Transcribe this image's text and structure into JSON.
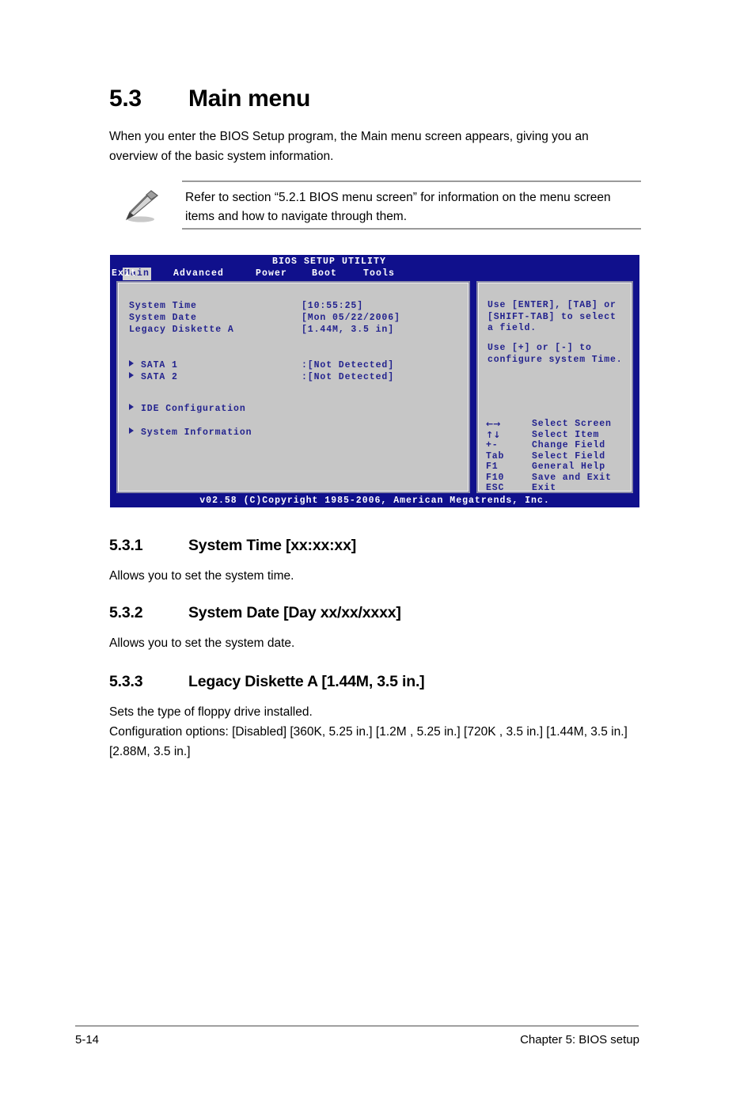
{
  "section": {
    "number": "5.3",
    "title": "Main menu",
    "intro": "When you enter the BIOS Setup program, the Main menu screen appears, giving you an overview of the basic system information."
  },
  "note": {
    "icon": "pencil-icon",
    "text": "Refer to section “5.2.1  BIOS menu screen” for information on the menu screen items and how to navigate through them."
  },
  "bios": {
    "title": "BIOS SETUP UTILITY",
    "tabs": [
      {
        "label": "Main",
        "active": true
      },
      {
        "label": "Advanced",
        "active": false
      },
      {
        "label": "Power",
        "active": false
      },
      {
        "label": "Boot",
        "active": false
      },
      {
        "label": "Tools",
        "active": false
      },
      {
        "label": "Exit",
        "active": false
      }
    ],
    "fields": [
      {
        "label": "System Time",
        "value": "[10:55:25]"
      },
      {
        "label": "System Date",
        "value": "[Mon 05/22/2006]"
      },
      {
        "label": "Legacy Diskette A",
        "value": "[1.44M, 3.5 in]"
      }
    ],
    "devices": [
      {
        "label": "SATA 1",
        "value": ":[Not Detected]"
      },
      {
        "label": "SATA 2",
        "value": ":[Not Detected]"
      }
    ],
    "submenus": [
      {
        "label": "IDE Configuration"
      },
      {
        "label": "System Information"
      }
    ],
    "help": [
      "Use [ENTER], [TAB] or\n[SHIFT-TAB] to select\na field.",
      "Use [+] or [-] to\nconfigure system Time."
    ],
    "keys": [
      {
        "key": "←→",
        "desc": "Select Screen",
        "glyph": true
      },
      {
        "key": "↑↓",
        "desc": "Select Item",
        "glyph": true
      },
      {
        "key": "+-",
        "desc": "Change Field",
        "glyph": false
      },
      {
        "key": "Tab",
        "desc": "Select Field",
        "glyph": false
      },
      {
        "key": "F1",
        "desc": "General Help",
        "glyph": false
      },
      {
        "key": "F10",
        "desc": "Save and Exit",
        "glyph": false
      },
      {
        "key": "ESC",
        "desc": "Exit",
        "glyph": false
      }
    ],
    "footer": "v02.58 (C)Copyright 1985-2006, American Megatrends, Inc.",
    "colors": {
      "background": "#10108c",
      "panel": "#c6c6c6",
      "text": "#23238e",
      "tab_active_bg": "#d3d3d3"
    }
  },
  "subsections": [
    {
      "number": "5.3.1",
      "title": "System Time [xx:xx:xx]",
      "body": [
        "Allows you to set the system time."
      ]
    },
    {
      "number": "5.3.2",
      "title": "System Date [Day xx/xx/xxxx]",
      "body": [
        "Allows you to set the system date."
      ]
    },
    {
      "number": "5.3.3",
      "title": "Legacy Diskette A [1.44M, 3.5 in.]",
      "body": [
        "Sets the type of floppy drive installed.",
        "Configuration options: [Disabled] [360K, 5.25 in.] [1.2M , 5.25 in.] [720K , 3.5 in.] [1.44M, 3.5 in.] [2.88M, 3.5 in.]"
      ]
    }
  ],
  "footer": {
    "page": "5-14",
    "chapter": "Chapter 5: BIOS setup"
  }
}
